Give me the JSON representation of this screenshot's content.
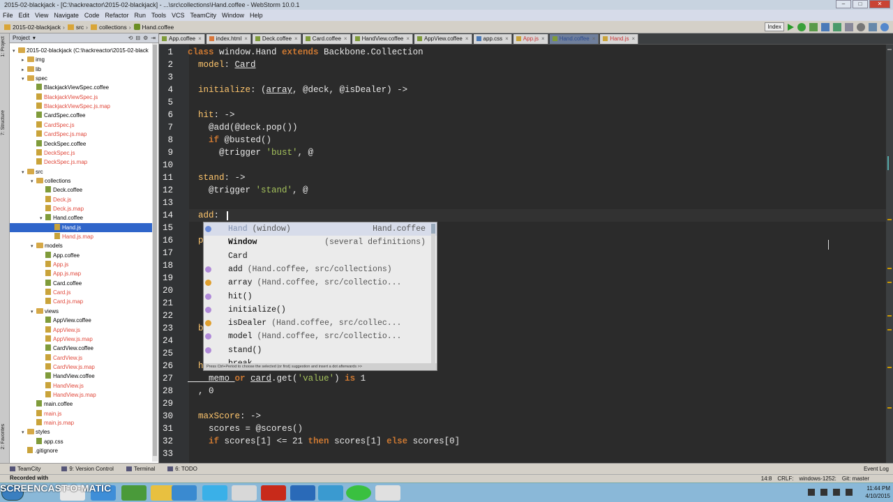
{
  "window": {
    "title": "2015-02-blackjack - [C:\\hackreactor\\2015-02-blackjack] - ...\\src\\collections\\Hand.coffee - WebStorm 10.0.1"
  },
  "menu": [
    "File",
    "Edit",
    "View",
    "Navigate",
    "Code",
    "Refactor",
    "Run",
    "Tools",
    "VCS",
    "TeamCity",
    "Window",
    "Help"
  ],
  "breadcrumbs": [
    "2015-02-blackjack",
    "src",
    "collections",
    "Hand.coffee"
  ],
  "nav_right": {
    "dropdown": "Index"
  },
  "left_strip": {
    "project": "1: Project",
    "structure": "7: Structure",
    "favorites": "2: Favorites"
  },
  "project": {
    "header": "Project",
    "tree": [
      {
        "label": "2015-02-blackjack (C:\\hackreactor\\2015-02-black",
        "kind": "folder",
        "depth": 0,
        "open": true
      },
      {
        "label": "img",
        "kind": "folder",
        "depth": 1,
        "open": false
      },
      {
        "label": "lib",
        "kind": "folder",
        "depth": 1,
        "open": false
      },
      {
        "label": "spec",
        "kind": "folder",
        "depth": 1,
        "open": true
      },
      {
        "label": "BlackjackViewSpec.coffee",
        "kind": "cf",
        "depth": 2
      },
      {
        "label": "BlackjackViewSpec.js",
        "kind": "js",
        "depth": 2,
        "red": true
      },
      {
        "label": "BlackjackViewSpec.js.map",
        "kind": "js",
        "depth": 2,
        "red": true
      },
      {
        "label": "CardSpec.coffee",
        "kind": "cf",
        "depth": 2
      },
      {
        "label": "CardSpec.js",
        "kind": "js",
        "depth": 2,
        "red": true
      },
      {
        "label": "CardSpec.js.map",
        "kind": "js",
        "depth": 2,
        "red": true
      },
      {
        "label": "DeckSpec.coffee",
        "kind": "cf",
        "depth": 2
      },
      {
        "label": "DeckSpec.js",
        "kind": "js",
        "depth": 2,
        "red": true
      },
      {
        "label": "DeckSpec.js.map",
        "kind": "js",
        "depth": 2,
        "red": true
      },
      {
        "label": "src",
        "kind": "folder",
        "depth": 1,
        "open": true
      },
      {
        "label": "collections",
        "kind": "folder",
        "depth": 2,
        "open": true
      },
      {
        "label": "Deck.coffee",
        "kind": "cf",
        "depth": 3
      },
      {
        "label": "Deck.js",
        "kind": "js",
        "depth": 3,
        "red": true
      },
      {
        "label": "Deck.js.map",
        "kind": "js",
        "depth": 3,
        "red": true
      },
      {
        "label": "Hand.coffee",
        "kind": "cf",
        "depth": 3,
        "open": true
      },
      {
        "label": "Hand.js",
        "kind": "js",
        "depth": 4,
        "selected": true
      },
      {
        "label": "Hand.js.map",
        "kind": "js",
        "depth": 4,
        "red": true
      },
      {
        "label": "models",
        "kind": "folder",
        "depth": 2,
        "open": true
      },
      {
        "label": "App.coffee",
        "kind": "cf",
        "depth": 3
      },
      {
        "label": "App.js",
        "kind": "js",
        "depth": 3,
        "red": true
      },
      {
        "label": "App.js.map",
        "kind": "js",
        "depth": 3,
        "red": true
      },
      {
        "label": "Card.coffee",
        "kind": "cf",
        "depth": 3
      },
      {
        "label": "Card.js",
        "kind": "js",
        "depth": 3,
        "red": true
      },
      {
        "label": "Card.js.map",
        "kind": "js",
        "depth": 3,
        "red": true
      },
      {
        "label": "views",
        "kind": "folder",
        "depth": 2,
        "open": true
      },
      {
        "label": "AppView.coffee",
        "kind": "cf",
        "depth": 3
      },
      {
        "label": "AppView.js",
        "kind": "js",
        "depth": 3,
        "red": true
      },
      {
        "label": "AppView.js.map",
        "kind": "js",
        "depth": 3,
        "red": true
      },
      {
        "label": "CardView.coffee",
        "kind": "cf",
        "depth": 3
      },
      {
        "label": "CardView.js",
        "kind": "js",
        "depth": 3,
        "red": true
      },
      {
        "label": "CardView.js.map",
        "kind": "js",
        "depth": 3,
        "red": true
      },
      {
        "label": "HandView.coffee",
        "kind": "cf",
        "depth": 3
      },
      {
        "label": "HandView.js",
        "kind": "js",
        "depth": 3,
        "red": true
      },
      {
        "label": "HandView.js.map",
        "kind": "js",
        "depth": 3,
        "red": true
      },
      {
        "label": "main.coffee",
        "kind": "cf",
        "depth": 2
      },
      {
        "label": "main.js",
        "kind": "js",
        "depth": 2,
        "red": true
      },
      {
        "label": "main.js.map",
        "kind": "js",
        "depth": 2,
        "red": true
      },
      {
        "label": "styles",
        "kind": "folder",
        "depth": 1,
        "open": true
      },
      {
        "label": "app.css",
        "kind": "cf",
        "depth": 2
      },
      {
        "label": ".gitignore",
        "kind": "js",
        "depth": 1
      }
    ]
  },
  "tabs": [
    {
      "label": "App.coffee",
      "state": "normal"
    },
    {
      "label": "index.html",
      "state": "normal"
    },
    {
      "label": "Deck.coffee",
      "state": "normal"
    },
    {
      "label": "Card.coffee",
      "state": "normal"
    },
    {
      "label": "HandView.coffee",
      "state": "normal"
    },
    {
      "label": "AppView.coffee",
      "state": "normal"
    },
    {
      "label": "app.css",
      "state": "normal"
    },
    {
      "label": "App.js",
      "state": "err"
    },
    {
      "label": "Hand.coffee",
      "state": "active"
    },
    {
      "label": "Hand.js",
      "state": "err"
    }
  ],
  "editor": {
    "line_numbers": [
      "1",
      "2",
      "3",
      "4",
      "5",
      "6",
      "7",
      "8",
      "9",
      "10",
      "11",
      "12",
      "13",
      "14",
      "15",
      "16",
      "17",
      "18",
      "19",
      "20",
      "21",
      "22",
      "23",
      "24",
      "25",
      "26",
      "27",
      "28",
      "29",
      "30",
      "31",
      "32",
      "33"
    ],
    "lines": [
      [
        [
          "kw",
          "class "
        ],
        [
          "cls",
          "window.Hand "
        ],
        [
          "kw",
          "extends "
        ],
        [
          "cls",
          "Backbone.Collection"
        ]
      ],
      [
        [
          "fn",
          "  model"
        ],
        [
          "cls",
          ": "
        ],
        [
          "ul",
          "Card"
        ]
      ],
      [],
      [
        [
          "fn",
          "  initialize"
        ],
        [
          "cls",
          ": ("
        ],
        [
          "ul",
          "array"
        ],
        [
          "cls",
          ", @deck, @isDealer) ->"
        ]
      ],
      [],
      [
        [
          "fn",
          "  hit"
        ],
        [
          "cls",
          ": ->"
        ]
      ],
      [
        [
          "cls",
          "    @add(@deck.pop())"
        ]
      ],
      [
        [
          "kw",
          "    if "
        ],
        [
          "cls",
          "@busted()"
        ]
      ],
      [
        [
          "cls",
          "      @trigger "
        ],
        [
          "str",
          "'bust'"
        ],
        [
          "cls",
          ", @"
        ]
      ],
      [],
      [
        [
          "fn",
          "  stand"
        ],
        [
          "cls",
          ": ->"
        ]
      ],
      [
        [
          "cls",
          "    @trigger "
        ],
        [
          "str",
          "'stand'"
        ],
        [
          "cls",
          ", @"
        ]
      ],
      [],
      [
        [
          "fn",
          "  add"
        ],
        [
          "cls",
          ": "
        ]
      ],
      [],
      [
        [
          "fn",
          "  p"
        ]
      ],
      [],
      [],
      [],
      [],
      [],
      [],
      [
        [
          "fn",
          "  b"
        ]
      ],
      [],
      [],
      [
        [
          "fn",
          "  h"
        ]
      ],
      [
        [
          "ul",
          "    memo "
        ],
        [
          "kw",
          "or "
        ],
        [
          "ul",
          "card"
        ],
        [
          "cls",
          ".get("
        ],
        [
          "str",
          "'value'"
        ],
        [
          "cls",
          ") "
        ],
        [
          "kw",
          "is "
        ],
        [
          "cls",
          "1"
        ]
      ],
      [
        [
          "cls",
          "  , 0"
        ]
      ],
      [],
      [
        [
          "fn",
          "  maxScore"
        ],
        [
          "cls",
          ": ->"
        ]
      ],
      [
        [
          "cls",
          "    scores = @scores()"
        ]
      ],
      [
        [
          "kw",
          "    if "
        ],
        [
          "cls",
          "scores[1] <= 21 "
        ],
        [
          "kw",
          "then "
        ],
        [
          "cls",
          "scores[1] "
        ],
        [
          "kw",
          "else "
        ],
        [
          "cls",
          "scores[0]"
        ]
      ],
      []
    ]
  },
  "autocomplete": {
    "items": [
      {
        "name": "Hand",
        "detail": "(window)",
        "tail": "Hand.coffee",
        "icon": "class-icon",
        "first": true
      },
      {
        "name": "Window",
        "detail": "",
        "tail": "(several definitions)",
        "icon": "none",
        "bold": true
      },
      {
        "name": "Card",
        "detail": "",
        "tail": "",
        "icon": "none"
      },
      {
        "name": "add",
        "detail": "(Hand.coffee, src/collections)",
        "tail": "",
        "icon": "method-icon"
      },
      {
        "name": "array",
        "detail": "(Hand.coffee, src/collectio...",
        "tail": "",
        "icon": "field-icon"
      },
      {
        "name": "hit()",
        "detail": "",
        "tail": "",
        "icon": "method-icon"
      },
      {
        "name": "initialize()",
        "detail": "",
        "tail": "",
        "icon": "method-icon"
      },
      {
        "name": "isDealer",
        "detail": "(Hand.coffee, src/collec...",
        "tail": "",
        "icon": "field-icon"
      },
      {
        "name": "model",
        "detail": "(Hand.coffee, src/collectio...",
        "tail": "",
        "icon": "method-icon"
      },
      {
        "name": "stand()",
        "detail": "",
        "tail": "",
        "icon": "method-icon"
      },
      {
        "name": "break",
        "detail": "",
        "tail": "",
        "icon": "none"
      }
    ],
    "hint": "Press Ctrl+Period to choose the selected (or first) suggestion and insert a dot afterwards  >>"
  },
  "statusbar": {
    "tools": [
      "TeamCity",
      "9: Version Control",
      "Terminal",
      "6: TODO"
    ],
    "event_log": "Event Log",
    "position": "14:8",
    "line_sep": "CRLF:",
    "encoding": "windows-1252:",
    "git": "Git: master"
  },
  "recording": {
    "label": "Recorded with",
    "brand": "SCREENCAST-O-MATIC"
  },
  "clock": {
    "time": "11:44 PM",
    "date": "4/10/2015"
  },
  "colors": {
    "keyword": "#cc7832",
    "function": "#ffc66d",
    "string": "#a5c25c",
    "selection": "#2f65ca"
  }
}
